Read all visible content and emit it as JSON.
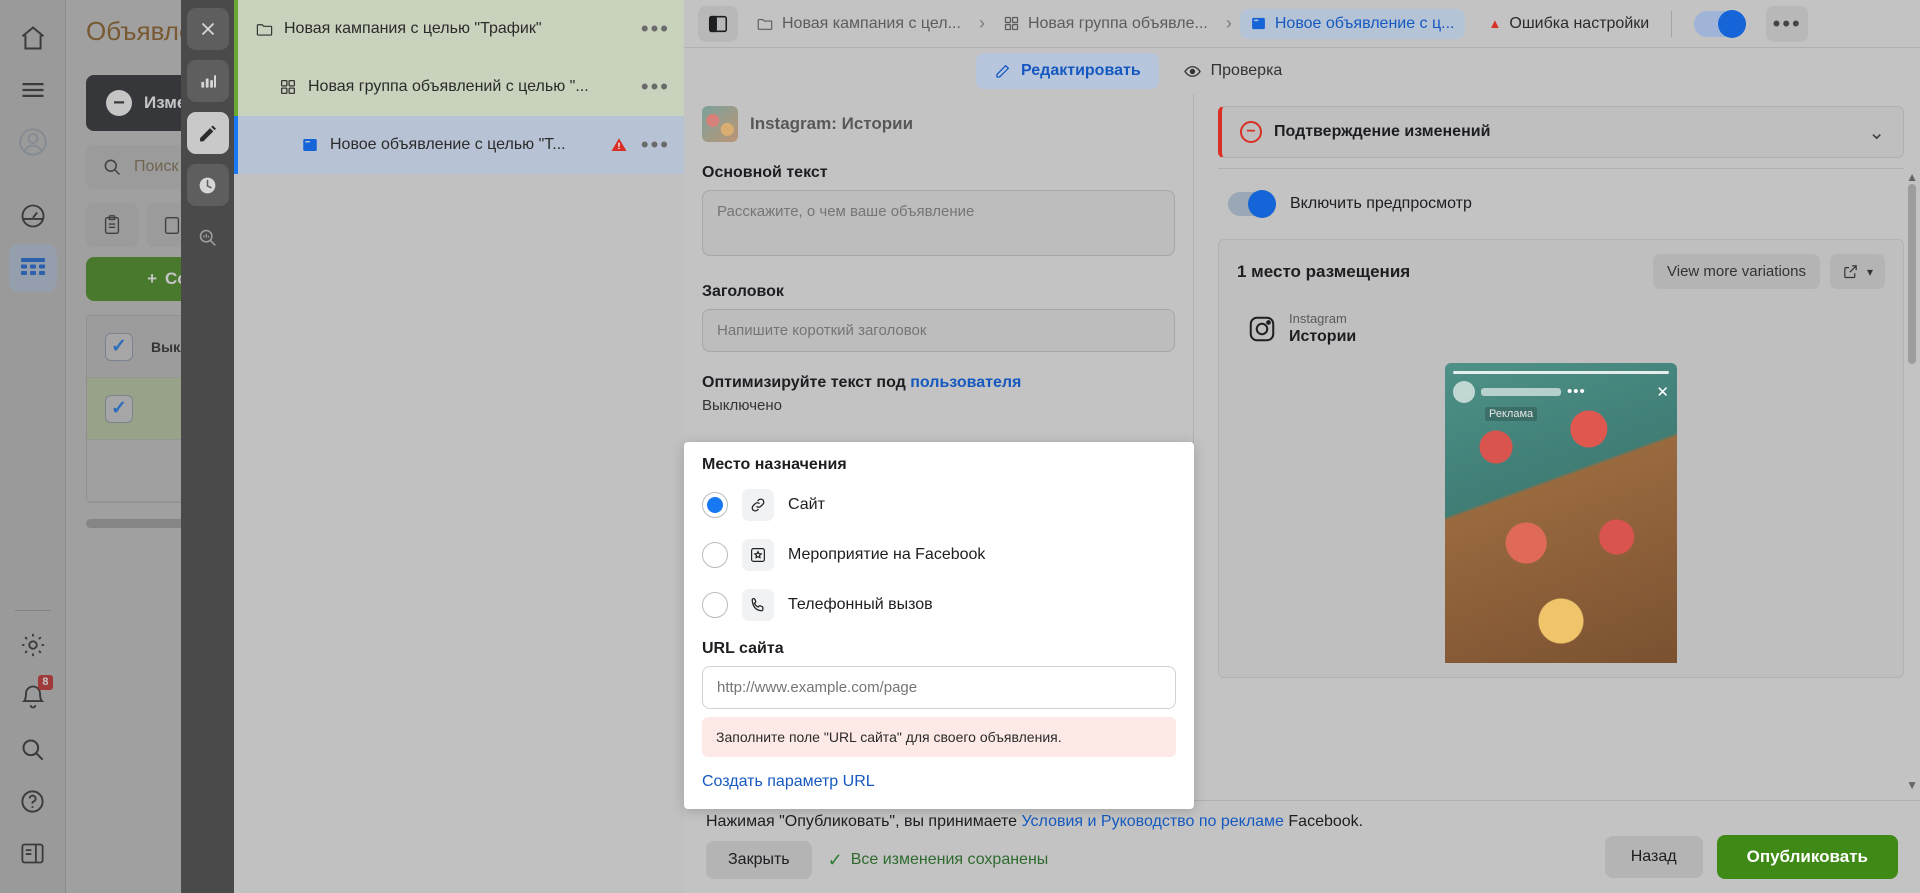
{
  "left_rail": {
    "items": [
      {
        "icon": "home-icon",
        "name": "home"
      },
      {
        "icon": "menu-icon",
        "name": "menu"
      },
      {
        "icon": "avatar-icon",
        "name": "account"
      },
      {
        "icon": "dashboard-icon",
        "name": "dashboard"
      },
      {
        "icon": "table-grid-icon",
        "name": "table"
      }
    ],
    "bottom_items": [
      {
        "icon": "gear-icon",
        "name": "settings"
      },
      {
        "icon": "bell-icon",
        "name": "notifications",
        "badge": "8"
      },
      {
        "icon": "search-icon",
        "name": "search"
      },
      {
        "icon": "help-icon",
        "name": "help"
      },
      {
        "icon": "panel-icon",
        "name": "toggle-panel"
      }
    ]
  },
  "left_panel": {
    "title": "Объявления",
    "notice": "Изменения",
    "search_placeholder": "Поиск",
    "create_button": "Создать",
    "row1_text": "Выключено / включено"
  },
  "vertical_toolbar": {
    "items": [
      {
        "icon": "close-icon",
        "name": "close",
        "active": false
      },
      {
        "icon": "chart-bar-icon",
        "name": "statistics",
        "active": false
      },
      {
        "icon": "pencil-icon",
        "name": "edit",
        "active": true
      },
      {
        "icon": "clock-icon",
        "name": "history",
        "active": false
      },
      {
        "icon": "magnify-chart-icon",
        "name": "inspect",
        "active": false
      }
    ]
  },
  "tree": {
    "items": [
      {
        "label": "Новая кампания с целью \"Трафик\"",
        "icon": "folder-icon",
        "level": "campaign",
        "warning": false
      },
      {
        "label": "Новая группа объявлений с целью \"...",
        "icon": "grid-icon",
        "level": "adset",
        "warning": false
      },
      {
        "label": "Новое объявление с целью \"Т...",
        "icon": "ad-icon",
        "level": "ad",
        "warning": true
      }
    ],
    "menu_glyph": "•••"
  },
  "topbar": {
    "panel_toggle_icon": "sidebar-panel-icon",
    "breadcrumbs": [
      {
        "label": "Новая кампания с цел...",
        "icon": "folder-icon",
        "selected": false
      },
      {
        "label": "Новая группа объявле...",
        "icon": "grid-icon",
        "selected": false
      },
      {
        "label": "Новое объявление с ц...",
        "icon": "ad-icon",
        "selected": true
      }
    ],
    "chevron": "›",
    "error_label": "Ошибка настройки",
    "error_glyph": "▲",
    "more_glyph": "•••"
  },
  "tabs": [
    {
      "label": "Редактировать",
      "icon": "pencil-icon",
      "active": true
    },
    {
      "label": "Проверка",
      "icon": "eye-icon",
      "active": false
    }
  ],
  "form": {
    "placement_thumb_label": "Instagram: Истории",
    "primary_text_label": "Основной текст",
    "primary_text_placeholder": "Расскажите, о чем ваше объявление",
    "primary_text_value": "",
    "headline_label": "Заголовок",
    "headline_placeholder": "Напишите короткий заголовок",
    "headline_value": "",
    "optimize_label": "Оптимизируйте текст под ",
    "optimize_link": "пользователя",
    "optimize_value": "Выключено",
    "destination": {
      "title": "Место назначения",
      "options": [
        {
          "label": "Сайт",
          "icon": "link-icon",
          "selected": true
        },
        {
          "label": "Мероприятие на Facebook",
          "icon": "event-icon",
          "selected": false
        },
        {
          "label": "Телефонный вызов",
          "icon": "phone-icon",
          "selected": false
        }
      ],
      "url_label": "URL сайта",
      "url_placeholder": "http://www.example.com/page",
      "url_value": "",
      "url_error": "Заполните поле \"URL сайта\" для своего объявления.",
      "url_param_link": "Создать параметр URL"
    }
  },
  "preview": {
    "confirm_title": "Подтверждение изменений",
    "confirm_chevron": "⌄",
    "toggle_label": "Включить предпросмотр",
    "placements_count": "1 место размещения",
    "view_more": "View more variations",
    "open_icon": "external-link-icon",
    "caret": "▾",
    "platform_name": "Instagram",
    "platform_surface": "Истории",
    "story_promo_label": "Реклама",
    "story_close_glyph": "✕",
    "story_dots_glyph": "•••"
  },
  "footer": {
    "legal_prefix": "Нажимая \"Опубликовать\", вы принимаете ",
    "legal_link": "Условия и Руководство по рекламе",
    "legal_suffix": " Facebook.",
    "close_button": "Закрыть",
    "saved_text": "Все изменения сохранены",
    "saved_check": "✓",
    "back_button": "Назад",
    "publish_button": "Опубликовать"
  },
  "colors": {
    "brand_blue": "#1877f2",
    "link_blue": "#1559c0",
    "publish_green": "#3f8a16",
    "error_red": "#d93025",
    "error_bg": "#fdeae7",
    "badge_red": "#c62828"
  }
}
